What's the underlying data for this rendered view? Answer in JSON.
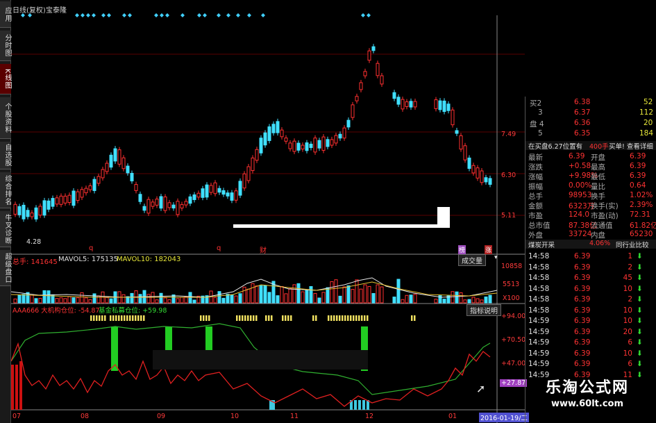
{
  "left_tabs": [
    "应用",
    "分时图",
    "K线图",
    "个股资料",
    "自选股",
    "综合排名",
    "牛叉诊断",
    "超级盘口"
  ],
  "title": {
    "chart_type": "日线(复权)",
    "stock": "宝泰隆"
  },
  "kline": {
    "y_labels": [
      "7.49",
      "6.30",
      "5.11"
    ],
    "low_label": "4.28",
    "markers": [
      "q",
      "q",
      "财",
      "榜",
      "涨"
    ]
  },
  "volume": {
    "label": "总手: 141645",
    "ma5": "MAVOL5: 175135",
    "ma10": "MAVOL10: 182043",
    "selector": "成交量",
    "y_labels": [
      "10858",
      "5513",
      "X100"
    ]
  },
  "indicator": {
    "label": "AAA666 大机构仓位: -54.87",
    "label2": "基金私募仓位: +59.98",
    "button": "指标说明",
    "y_labels": [
      "+94.00",
      "+70.50",
      "+47.00",
      "+27.87"
    ]
  },
  "x_axis": [
    "07",
    "08",
    "09",
    "10",
    "11",
    "12",
    "01"
  ],
  "date_badge": "2016-01-19/二",
  "order_book": {
    "sell": [
      {
        "label": "买2",
        "price": "6.38",
        "vol": "52"
      },
      {
        "label": "3",
        "price": "6.37",
        "vol": "112"
      },
      {
        "label": "盘 4",
        "price": "6.36",
        "vol": "20"
      },
      {
        "label": "5",
        "price": "6.35",
        "vol": "184"
      }
    ],
    "note_left": "在买盘6.27位置有",
    "note_mid": "400手",
    "note_right": "买单! 查看详细"
  },
  "quote": [
    [
      "最新",
      "6.39",
      "开盘",
      "6.39"
    ],
    [
      "涨跌",
      "+0.58",
      "最高",
      "6.39"
    ],
    [
      "涨幅",
      "+9.98%",
      "最低",
      "6.39"
    ],
    [
      "振幅",
      "0.00%",
      "量比",
      "0.64"
    ],
    [
      "总手",
      "98953",
      "换手",
      "1.02%"
    ],
    [
      "金额",
      "6323万",
      "换手(实)",
      "2.39%"
    ],
    [
      "市盈",
      "124.0",
      "市盈(动)",
      "72.31"
    ],
    [
      "总市值",
      "87.38亿",
      "流通值",
      "61.82亿"
    ],
    [
      "外盘",
      "33724",
      "内盘",
      "65230"
    ]
  ],
  "industry": {
    "name": "煤炭开采",
    "pct": "4.06%",
    "compare": "同行业比较"
  },
  "ticks": [
    [
      "14:58",
      "6.39",
      "1"
    ],
    [
      "14:58",
      "6.39",
      "2"
    ],
    [
      "14:58",
      "6.39",
      "45"
    ],
    [
      "14:58",
      "6.39",
      "10"
    ],
    [
      "14:58",
      "6.39",
      "2"
    ],
    [
      "14:58",
      "6.39",
      "10"
    ],
    [
      "14:59",
      "6.39",
      "10"
    ],
    [
      "14:59",
      "6.39",
      "20"
    ],
    [
      "14:59",
      "6.39",
      "6"
    ],
    [
      "14:59",
      "6.39",
      "10"
    ],
    [
      "14:59",
      "6.39",
      "6"
    ],
    [
      "14:59",
      "6.39",
      "11"
    ]
  ],
  "watermark": {
    "title": "乐淘公式网",
    "url": "www.60lt.com"
  }
}
